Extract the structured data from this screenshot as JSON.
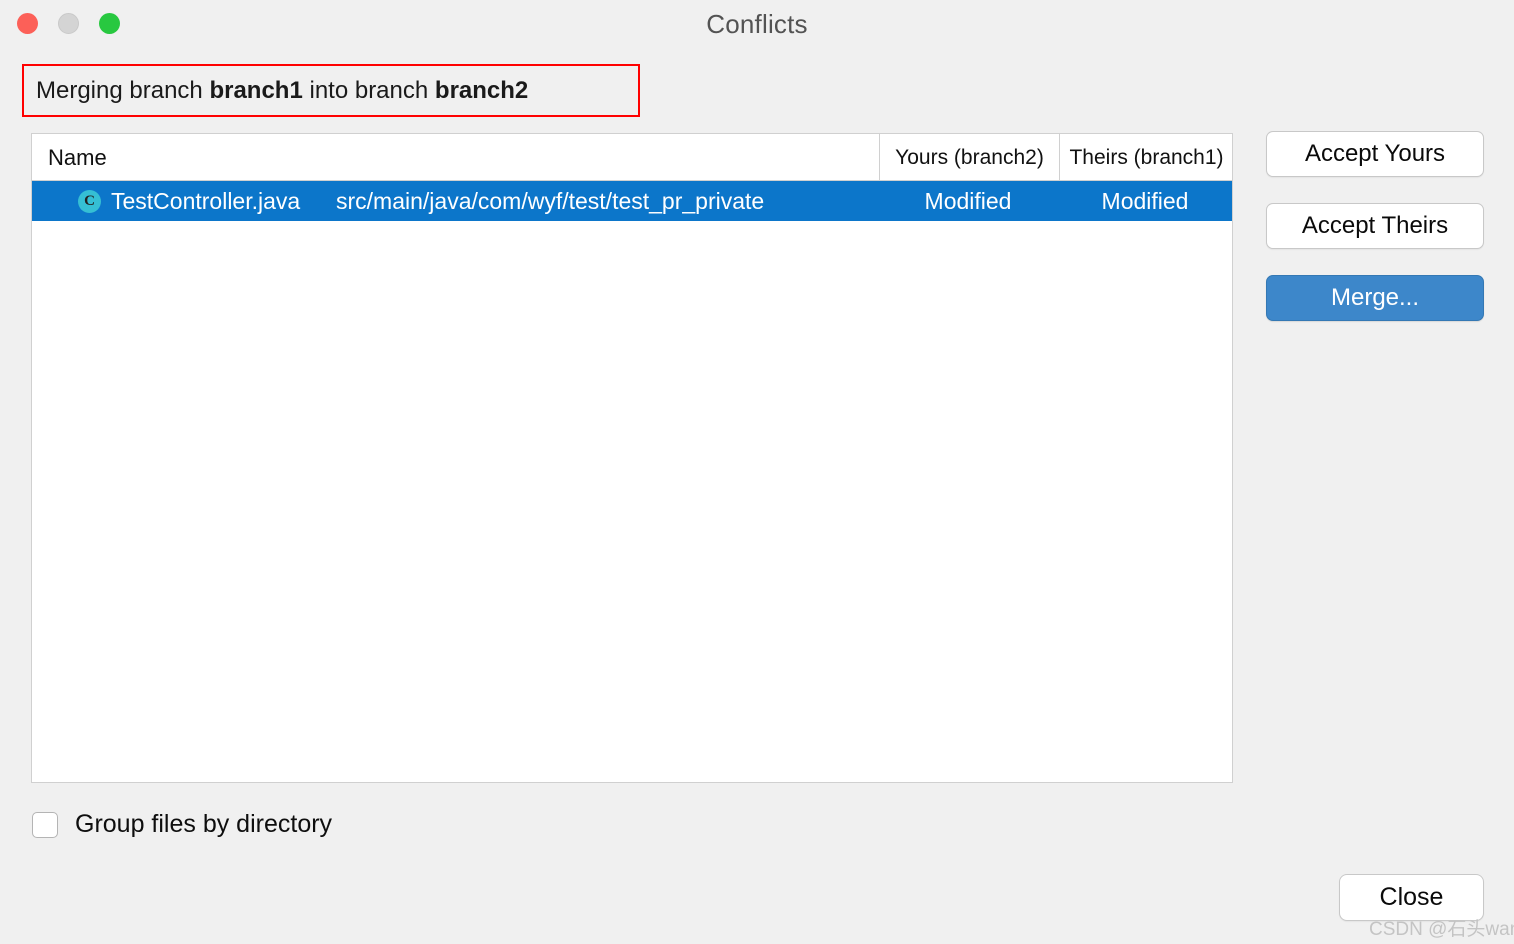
{
  "window": {
    "title": "Conflicts",
    "traffic_lights": {
      "close_label": "close-window",
      "minimize_label": "minimize-window",
      "zoom_label": "zoom-window",
      "close_color": "#fc6058",
      "minimize_color": "#d4d4d4",
      "zoom_color": "#28c840"
    },
    "background_color": "#f0f0f0"
  },
  "banner": {
    "prefix": "Merging branch ",
    "source_branch": "branch1",
    "middle": " into branch ",
    "target_branch": "branch2",
    "full_text": "Merging branch branch1 into branch branch2",
    "highlight_border_color": "#ff0000"
  },
  "table": {
    "columns": [
      {
        "key": "name",
        "label": "Name"
      },
      {
        "key": "yours",
        "label": "Yours (branch2)"
      },
      {
        "key": "theirs",
        "label": "Theirs (branch1)"
      }
    ],
    "rows": [
      {
        "icon": "java-class-icon",
        "icon_letter": "C",
        "icon_color": "#35bfd4",
        "name": "TestController.java",
        "path": "src/main/java/com/wyf/test/test_pr_private",
        "yours": "Modified",
        "theirs": "Modified",
        "selected": true,
        "selection_color": "#0c76ca"
      }
    ]
  },
  "actions": {
    "accept_yours_label": "Accept Yours",
    "accept_theirs_label": "Accept Theirs",
    "merge_label": "Merge...",
    "merge_accent_color": "#3d87ca"
  },
  "options": {
    "group_files_by_directory_label": "Group files by directory",
    "group_files_by_directory_checked": false
  },
  "footer": {
    "close_label": "Close"
  },
  "watermark": {
    "text": "CSDN @石头wang"
  }
}
